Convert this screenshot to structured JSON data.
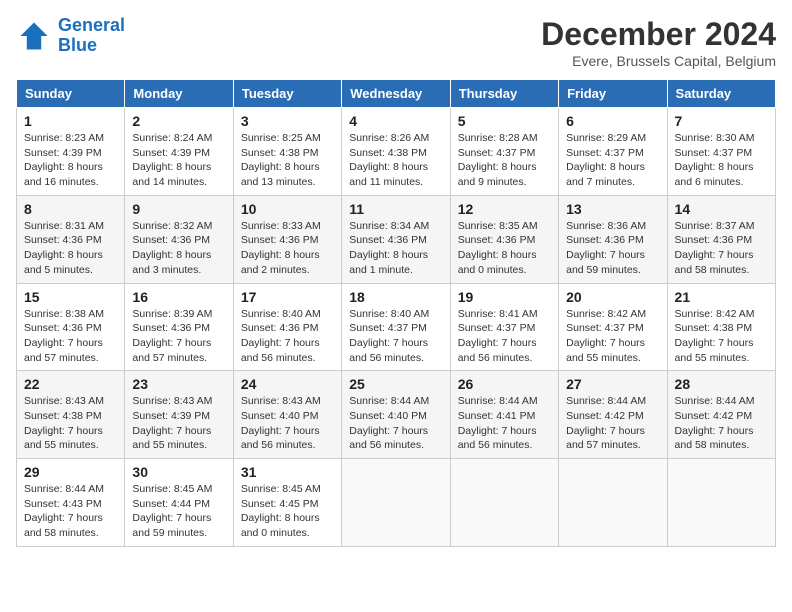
{
  "logo": {
    "line1": "General",
    "line2": "Blue"
  },
  "title": "December 2024",
  "location": "Evere, Brussels Capital, Belgium",
  "days_of_week": [
    "Sunday",
    "Monday",
    "Tuesday",
    "Wednesday",
    "Thursday",
    "Friday",
    "Saturday"
  ],
  "weeks": [
    [
      {
        "day": "1",
        "sunrise": "8:23 AM",
        "sunset": "4:39 PM",
        "daylight": "8 hours and 16 minutes."
      },
      {
        "day": "2",
        "sunrise": "8:24 AM",
        "sunset": "4:39 PM",
        "daylight": "8 hours and 14 minutes."
      },
      {
        "day": "3",
        "sunrise": "8:25 AM",
        "sunset": "4:38 PM",
        "daylight": "8 hours and 13 minutes."
      },
      {
        "day": "4",
        "sunrise": "8:26 AM",
        "sunset": "4:38 PM",
        "daylight": "8 hours and 11 minutes."
      },
      {
        "day": "5",
        "sunrise": "8:28 AM",
        "sunset": "4:37 PM",
        "daylight": "8 hours and 9 minutes."
      },
      {
        "day": "6",
        "sunrise": "8:29 AM",
        "sunset": "4:37 PM",
        "daylight": "8 hours and 7 minutes."
      },
      {
        "day": "7",
        "sunrise": "8:30 AM",
        "sunset": "4:37 PM",
        "daylight": "8 hours and 6 minutes."
      }
    ],
    [
      {
        "day": "8",
        "sunrise": "8:31 AM",
        "sunset": "4:36 PM",
        "daylight": "8 hours and 5 minutes."
      },
      {
        "day": "9",
        "sunrise": "8:32 AM",
        "sunset": "4:36 PM",
        "daylight": "8 hours and 3 minutes."
      },
      {
        "day": "10",
        "sunrise": "8:33 AM",
        "sunset": "4:36 PM",
        "daylight": "8 hours and 2 minutes."
      },
      {
        "day": "11",
        "sunrise": "8:34 AM",
        "sunset": "4:36 PM",
        "daylight": "8 hours and 1 minute."
      },
      {
        "day": "12",
        "sunrise": "8:35 AM",
        "sunset": "4:36 PM",
        "daylight": "8 hours and 0 minutes."
      },
      {
        "day": "13",
        "sunrise": "8:36 AM",
        "sunset": "4:36 PM",
        "daylight": "7 hours and 59 minutes."
      },
      {
        "day": "14",
        "sunrise": "8:37 AM",
        "sunset": "4:36 PM",
        "daylight": "7 hours and 58 minutes."
      }
    ],
    [
      {
        "day": "15",
        "sunrise": "8:38 AM",
        "sunset": "4:36 PM",
        "daylight": "7 hours and 57 minutes."
      },
      {
        "day": "16",
        "sunrise": "8:39 AM",
        "sunset": "4:36 PM",
        "daylight": "7 hours and 57 minutes."
      },
      {
        "day": "17",
        "sunrise": "8:40 AM",
        "sunset": "4:36 PM",
        "daylight": "7 hours and 56 minutes."
      },
      {
        "day": "18",
        "sunrise": "8:40 AM",
        "sunset": "4:37 PM",
        "daylight": "7 hours and 56 minutes."
      },
      {
        "day": "19",
        "sunrise": "8:41 AM",
        "sunset": "4:37 PM",
        "daylight": "7 hours and 56 minutes."
      },
      {
        "day": "20",
        "sunrise": "8:42 AM",
        "sunset": "4:37 PM",
        "daylight": "7 hours and 55 minutes."
      },
      {
        "day": "21",
        "sunrise": "8:42 AM",
        "sunset": "4:38 PM",
        "daylight": "7 hours and 55 minutes."
      }
    ],
    [
      {
        "day": "22",
        "sunrise": "8:43 AM",
        "sunset": "4:38 PM",
        "daylight": "7 hours and 55 minutes."
      },
      {
        "day": "23",
        "sunrise": "8:43 AM",
        "sunset": "4:39 PM",
        "daylight": "7 hours and 55 minutes."
      },
      {
        "day": "24",
        "sunrise": "8:43 AM",
        "sunset": "4:40 PM",
        "daylight": "7 hours and 56 minutes."
      },
      {
        "day": "25",
        "sunrise": "8:44 AM",
        "sunset": "4:40 PM",
        "daylight": "7 hours and 56 minutes."
      },
      {
        "day": "26",
        "sunrise": "8:44 AM",
        "sunset": "4:41 PM",
        "daylight": "7 hours and 56 minutes."
      },
      {
        "day": "27",
        "sunrise": "8:44 AM",
        "sunset": "4:42 PM",
        "daylight": "7 hours and 57 minutes."
      },
      {
        "day": "28",
        "sunrise": "8:44 AM",
        "sunset": "4:42 PM",
        "daylight": "7 hours and 58 minutes."
      }
    ],
    [
      {
        "day": "29",
        "sunrise": "8:44 AM",
        "sunset": "4:43 PM",
        "daylight": "7 hours and 58 minutes."
      },
      {
        "day": "30",
        "sunrise": "8:45 AM",
        "sunset": "4:44 PM",
        "daylight": "7 hours and 59 minutes."
      },
      {
        "day": "31",
        "sunrise": "8:45 AM",
        "sunset": "4:45 PM",
        "daylight": "8 hours and 0 minutes."
      },
      null,
      null,
      null,
      null
    ]
  ]
}
